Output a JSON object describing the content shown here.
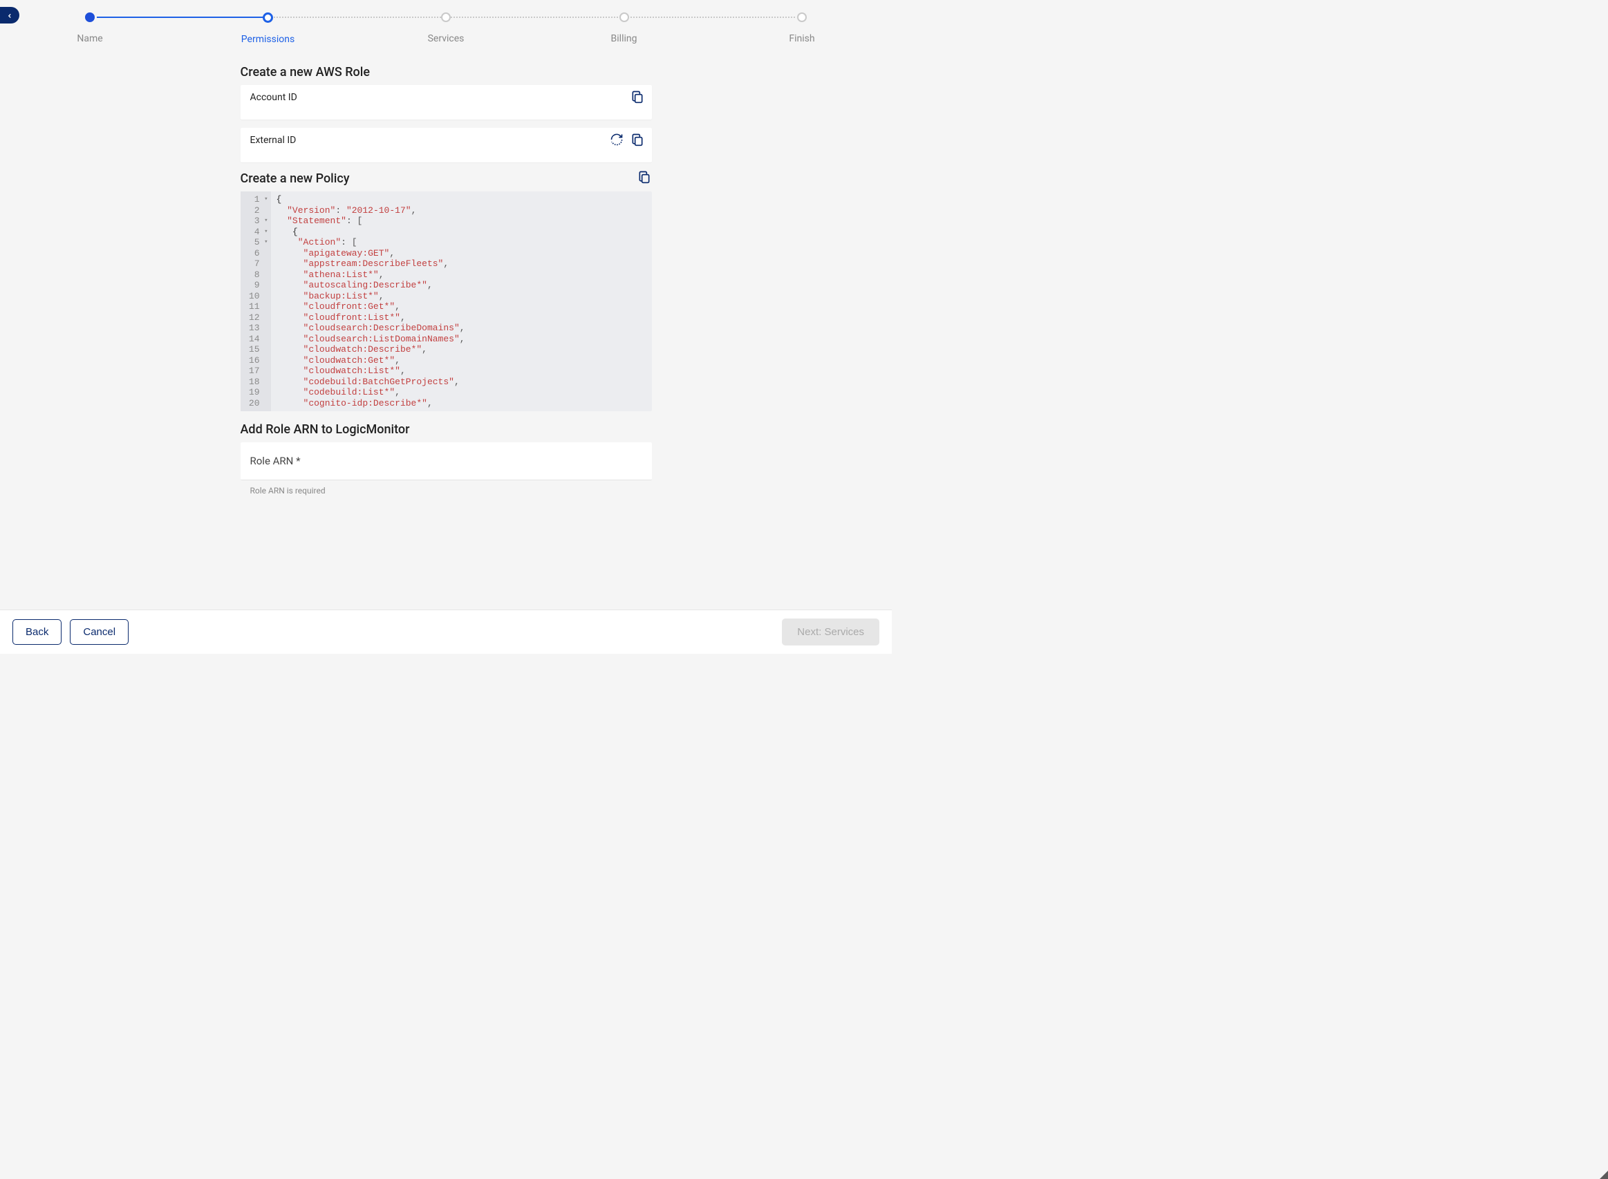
{
  "stepper": {
    "steps": [
      {
        "label": "Name",
        "state": "done"
      },
      {
        "label": "Permissions",
        "state": "active"
      },
      {
        "label": "Services",
        "state": "todo"
      },
      {
        "label": "Billing",
        "state": "todo"
      },
      {
        "label": "Finish",
        "state": "todo"
      }
    ]
  },
  "sections": {
    "create_role_title": "Create a new AWS Role",
    "account_id_label": "Account ID",
    "external_id_label": "External ID",
    "create_policy_title": "Create a new Policy",
    "add_arn_title": "Add Role ARN to LogicMonitor",
    "role_arn_label": "Role ARN *",
    "role_arn_hint": "Role ARN is required"
  },
  "policy_code": {
    "lines": [
      {
        "n": 1,
        "fold": true,
        "tokens": [
          [
            "brace",
            "{"
          ]
        ]
      },
      {
        "n": 2,
        "fold": false,
        "tokens": [
          [
            "indent",
            "  "
          ],
          [
            "key",
            "\"Version\""
          ],
          [
            "punct",
            ": "
          ],
          [
            "str",
            "\"2012-10-17\""
          ],
          [
            "punct",
            ","
          ]
        ]
      },
      {
        "n": 3,
        "fold": true,
        "tokens": [
          [
            "indent",
            "  "
          ],
          [
            "key",
            "\"Statement\""
          ],
          [
            "punct",
            ": ["
          ]
        ]
      },
      {
        "n": 4,
        "fold": true,
        "tokens": [
          [
            "indent",
            "   "
          ],
          [
            "brace",
            "{"
          ]
        ]
      },
      {
        "n": 5,
        "fold": true,
        "tokens": [
          [
            "indent",
            "    "
          ],
          [
            "key",
            "\"Action\""
          ],
          [
            "punct",
            ": ["
          ]
        ]
      },
      {
        "n": 6,
        "fold": false,
        "tokens": [
          [
            "indent",
            "     "
          ],
          [
            "str",
            "\"apigateway:GET\""
          ],
          [
            "punct",
            ","
          ]
        ]
      },
      {
        "n": 7,
        "fold": false,
        "tokens": [
          [
            "indent",
            "     "
          ],
          [
            "str",
            "\"appstream:DescribeFleets\""
          ],
          [
            "punct",
            ","
          ]
        ]
      },
      {
        "n": 8,
        "fold": false,
        "tokens": [
          [
            "indent",
            "     "
          ],
          [
            "str",
            "\"athena:List*\""
          ],
          [
            "punct",
            ","
          ]
        ]
      },
      {
        "n": 9,
        "fold": false,
        "tokens": [
          [
            "indent",
            "     "
          ],
          [
            "str",
            "\"autoscaling:Describe*\""
          ],
          [
            "punct",
            ","
          ]
        ]
      },
      {
        "n": 10,
        "fold": false,
        "tokens": [
          [
            "indent",
            "     "
          ],
          [
            "str",
            "\"backup:List*\""
          ],
          [
            "punct",
            ","
          ]
        ]
      },
      {
        "n": 11,
        "fold": false,
        "tokens": [
          [
            "indent",
            "     "
          ],
          [
            "str",
            "\"cloudfront:Get*\""
          ],
          [
            "punct",
            ","
          ]
        ]
      },
      {
        "n": 12,
        "fold": false,
        "tokens": [
          [
            "indent",
            "     "
          ],
          [
            "str",
            "\"cloudfront:List*\""
          ],
          [
            "punct",
            ","
          ]
        ]
      },
      {
        "n": 13,
        "fold": false,
        "tokens": [
          [
            "indent",
            "     "
          ],
          [
            "str",
            "\"cloudsearch:DescribeDomains\""
          ],
          [
            "punct",
            ","
          ]
        ]
      },
      {
        "n": 14,
        "fold": false,
        "tokens": [
          [
            "indent",
            "     "
          ],
          [
            "str",
            "\"cloudsearch:ListDomainNames\""
          ],
          [
            "punct",
            ","
          ]
        ]
      },
      {
        "n": 15,
        "fold": false,
        "tokens": [
          [
            "indent",
            "     "
          ],
          [
            "str",
            "\"cloudwatch:Describe*\""
          ],
          [
            "punct",
            ","
          ]
        ]
      },
      {
        "n": 16,
        "fold": false,
        "tokens": [
          [
            "indent",
            "     "
          ],
          [
            "str",
            "\"cloudwatch:Get*\""
          ],
          [
            "punct",
            ","
          ]
        ]
      },
      {
        "n": 17,
        "fold": false,
        "tokens": [
          [
            "indent",
            "     "
          ],
          [
            "str",
            "\"cloudwatch:List*\""
          ],
          [
            "punct",
            ","
          ]
        ]
      },
      {
        "n": 18,
        "fold": false,
        "tokens": [
          [
            "indent",
            "     "
          ],
          [
            "str",
            "\"codebuild:BatchGetProjects\""
          ],
          [
            "punct",
            ","
          ]
        ]
      },
      {
        "n": 19,
        "fold": false,
        "tokens": [
          [
            "indent",
            "     "
          ],
          [
            "str",
            "\"codebuild:List*\""
          ],
          [
            "punct",
            ","
          ]
        ]
      },
      {
        "n": 20,
        "fold": false,
        "tokens": [
          [
            "indent",
            "     "
          ],
          [
            "str",
            "\"cognito-idp:Describe*\""
          ],
          [
            "punct",
            ","
          ]
        ]
      }
    ]
  },
  "footer": {
    "back_label": "Back",
    "cancel_label": "Cancel",
    "next_label": "Next: Services"
  }
}
